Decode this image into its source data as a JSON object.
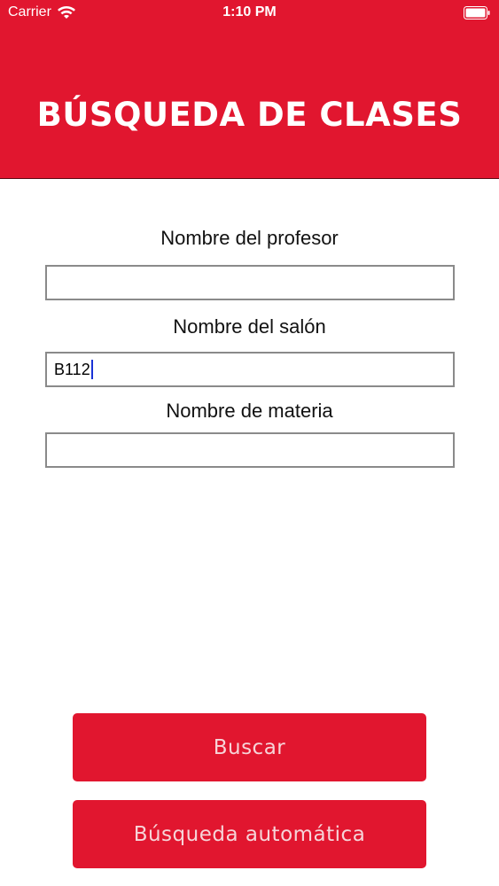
{
  "status_bar": {
    "carrier": "Carrier",
    "time": "1:10 PM"
  },
  "header": {
    "title": "BÚSQUEDA DE CLASES",
    "color": "#e1162f"
  },
  "form": {
    "professor_label": "Nombre del profesor",
    "professor_value": "",
    "room_label": "Nombre del salón",
    "room_value": "B112",
    "subject_label": "Nombre de materia",
    "subject_value": ""
  },
  "buttons": {
    "search_label": "Buscar",
    "auto_search_label": "Búsqueda automática"
  }
}
